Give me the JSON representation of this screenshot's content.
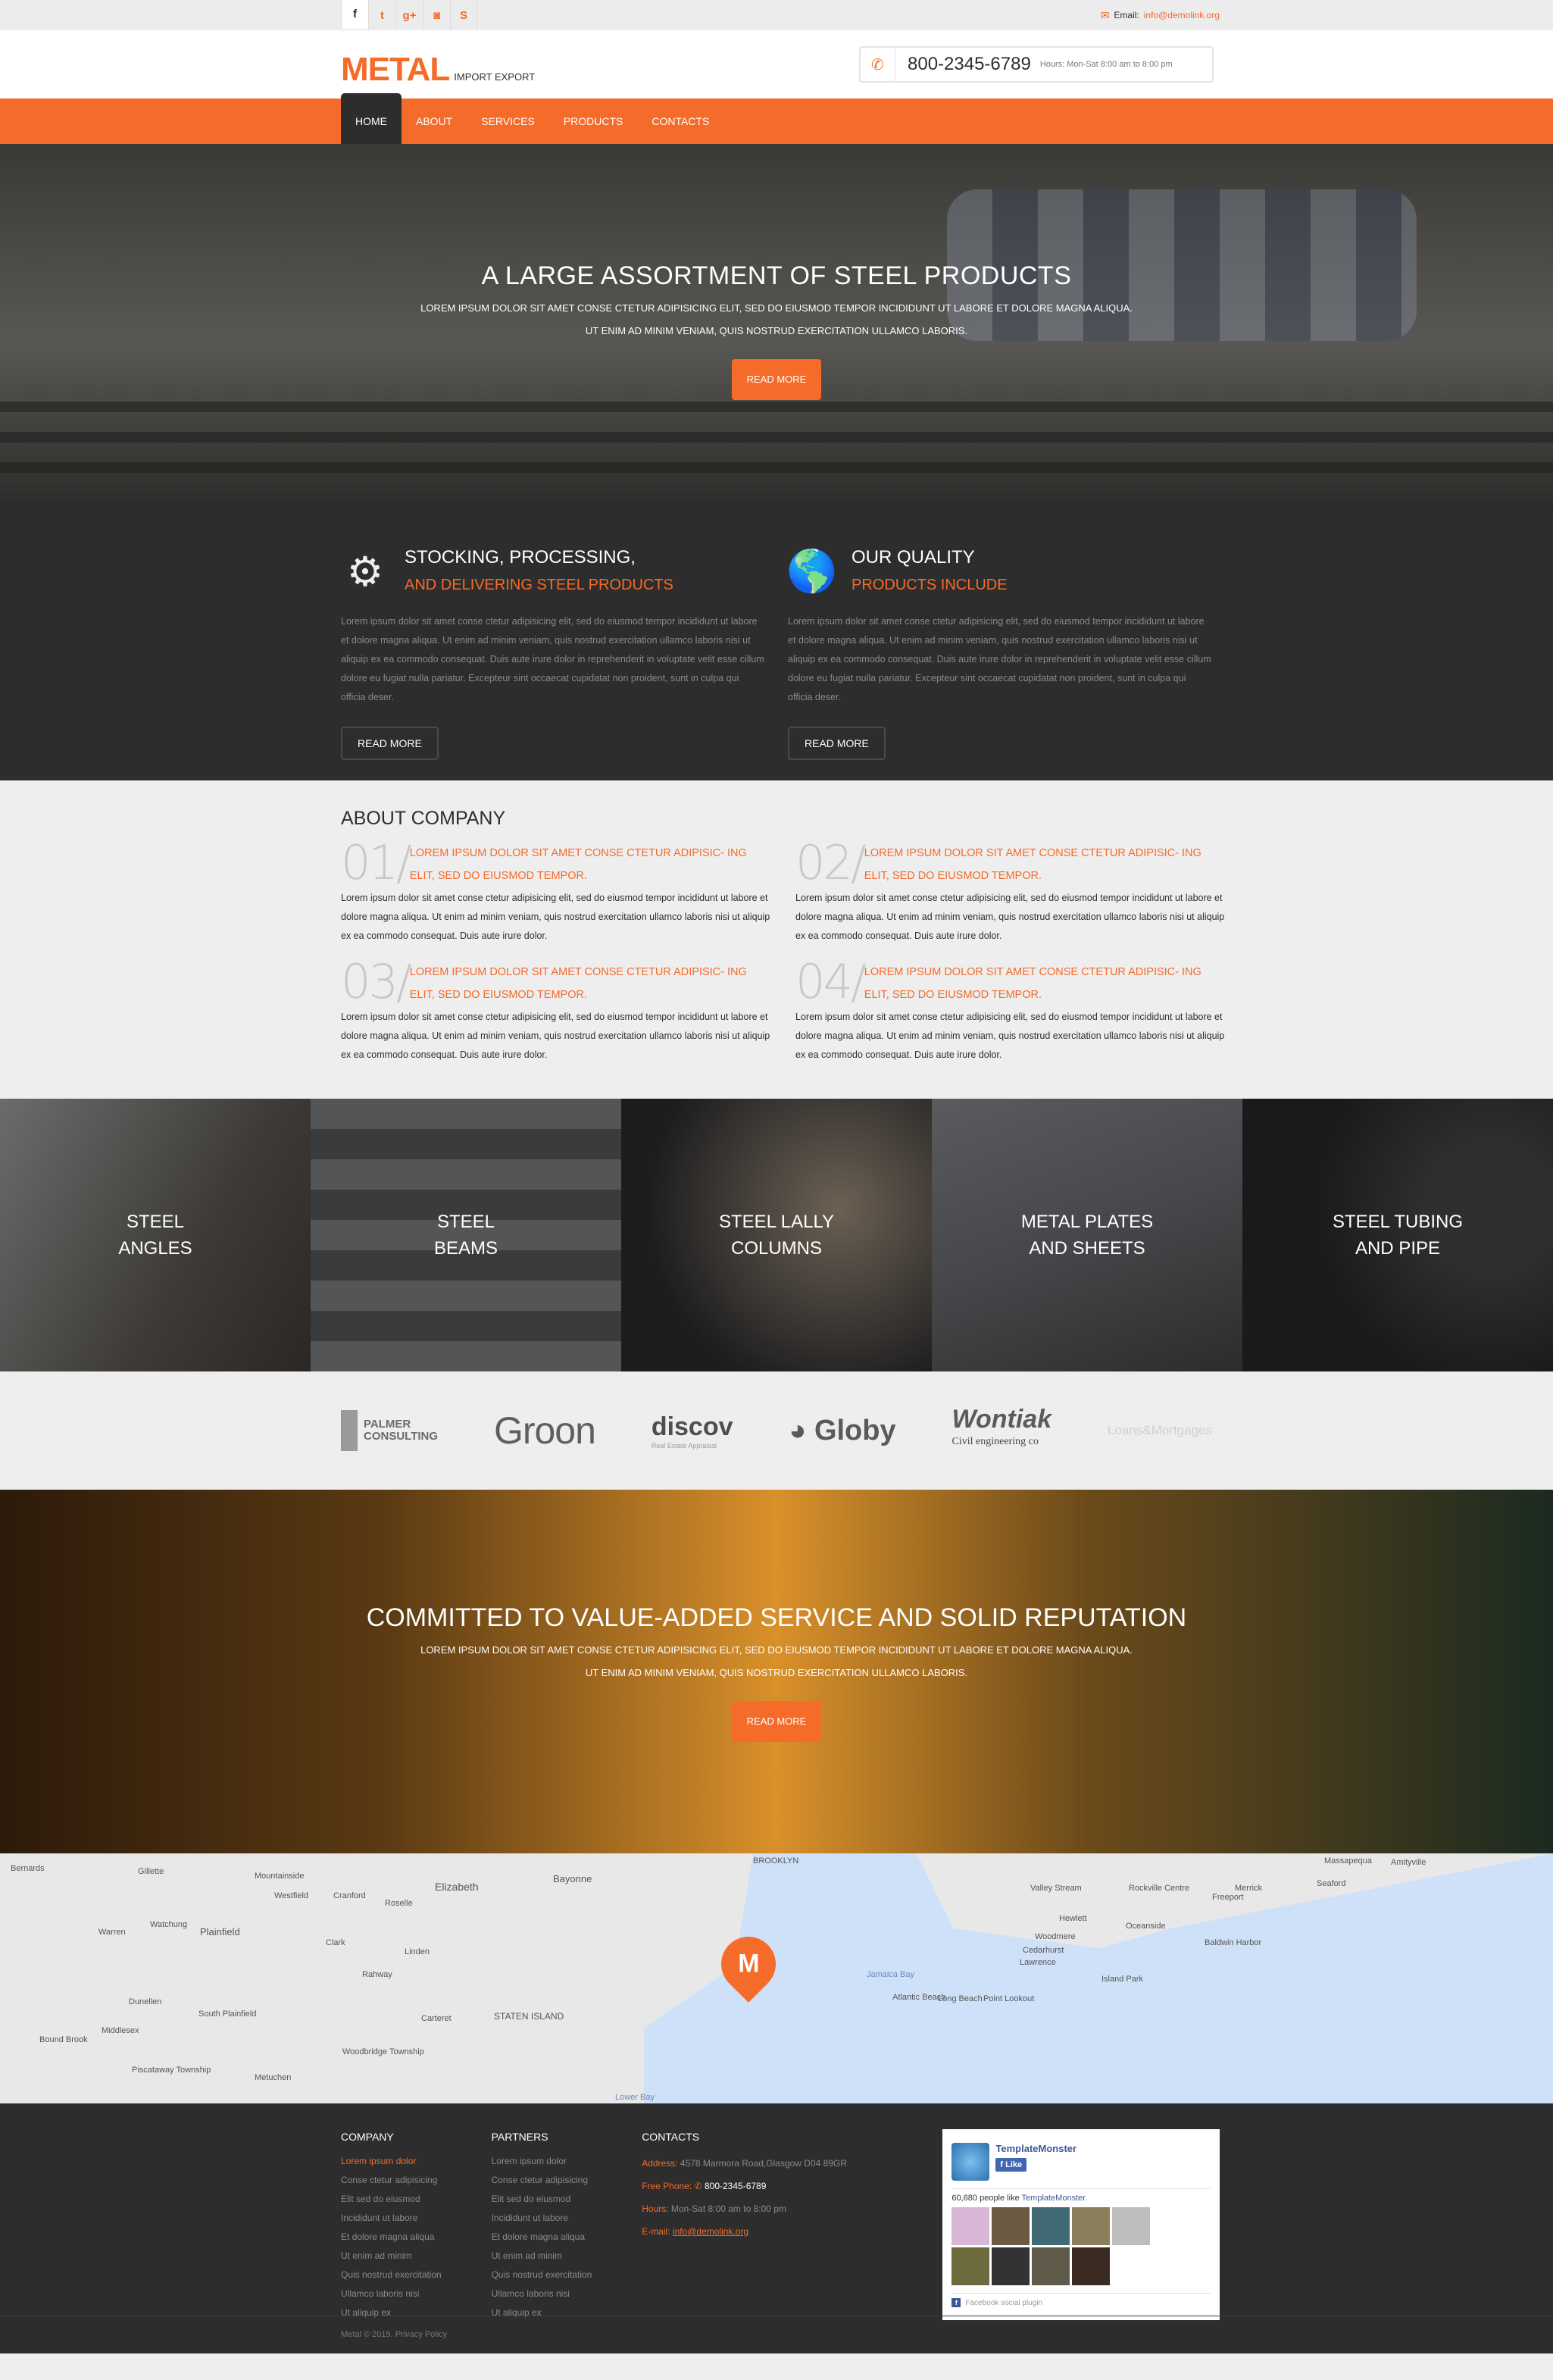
{
  "topbar": {
    "social_icons": [
      {
        "name": "facebook-icon",
        "glyph": "f"
      },
      {
        "name": "twitter-icon",
        "glyph": "t"
      },
      {
        "name": "google-plus-icon",
        "glyph": "g+"
      },
      {
        "name": "instagram-icon",
        "glyph": "◙"
      },
      {
        "name": "skype-icon",
        "glyph": "S"
      }
    ],
    "email_label": "Email:",
    "email": "info@demolink.org"
  },
  "header": {
    "logo_main": "METAL",
    "logo_sub": "IMPORT EXPORT",
    "phone": "800-2345-6789",
    "hours": "Hours: Mon-Sat 8:00 am to 8:00 pm"
  },
  "nav": [
    "HOME",
    "ABOUT",
    "SERVICES",
    "PRODUCTS",
    "CONTACTS"
  ],
  "hero": {
    "title": "A LARGE ASSORTMENT OF STEEL PRODUCTS",
    "line1": "LOREM IPSUM DOLOR SIT AMET CONSE CTETUR ADIPISICING ELIT, SED DO EIUSMOD TEMPOR INCIDIDUNT UT LABORE ET DOLORE MAGNA ALIQUA.",
    "line2": "UT ENIM AD MINIM VENIAM, QUIS NOSTRUD EXERCITATION ULLAMCO LABORIS.",
    "button": "READ MORE"
  },
  "features": [
    {
      "icon": "⚙",
      "title": "STOCKING, PROCESSING,",
      "subtitle": "AND DELIVERING STEEL PRODUCTS",
      "body": "Lorem ipsum dolor sit amet conse ctetur adipisicing elit, sed do eiusmod tempor incididunt ut labore et dolore magna aliqua. Ut enim ad minim veniam, quis nostrud exercitation ullamco laboris nisi ut aliquip ex ea commodo consequat. Duis aute irure dolor in reprehenderit in voluptate velit esse cillum dolore eu fugiat nulla pariatur. Excepteur sint occaecat cupidatat non proident, sunt in culpa qui officia deser.",
      "button": "READ MORE"
    },
    {
      "icon": "🌎",
      "title": "OUR QUALITY",
      "subtitle": "PRODUCTS INCLUDE",
      "body": "Lorem ipsum dolor sit amet conse ctetur adipisicing elit, sed do eiusmod tempor incididunt ut labore et dolore magna aliqua. Ut enim ad minim veniam, quis nostrud exercitation ullamco laboris nisi ut aliquip ex ea commodo consequat. Duis aute irure dolor in reprehenderit in voluptate velit esse cillum dolore eu fugiat nulla pariatur. Excepteur sint occaecat cupidatat non proident, sunt in culpa qui officia deser.",
      "button": "READ MORE"
    }
  ],
  "about": {
    "title": "ABOUT COMPANY",
    "items": [
      {
        "num": "01/",
        "title": "LOREM IPSUM DOLOR SIT AMET CONSE CTETUR ADIPISIC- ING ELIT, SED DO EIUSMOD TEMPOR.",
        "body": "Lorem ipsum dolor sit amet conse ctetur adipisicing elit, sed do eiusmod tempor incididunt ut labore et dolore magna aliqua. Ut enim ad minim veniam, quis nostrud exercitation ullamco laboris nisi ut aliquip ex ea commodo consequat. Duis aute irure dolor."
      },
      {
        "num": "02/",
        "title": "LOREM IPSUM DOLOR SIT AMET CONSE CTETUR ADIPISIC- ING ELIT, SED DO EIUSMOD TEMPOR.",
        "body": "Lorem ipsum dolor sit amet conse ctetur adipisicing elit, sed do eiusmod tempor incididunt ut labore et dolore magna aliqua. Ut enim ad minim veniam, quis nostrud exercitation ullamco laboris nisi ut aliquip ex ea commodo consequat. Duis aute irure dolor."
      },
      {
        "num": "03/",
        "title": "LOREM IPSUM DOLOR SIT AMET CONSE CTETUR ADIPISIC- ING ELIT, SED DO EIUSMOD TEMPOR.",
        "body": "Lorem ipsum dolor sit amet conse ctetur adipisicing elit, sed do eiusmod tempor incididunt ut labore et dolore magna aliqua. Ut enim ad minim veniam, quis nostrud exercitation ullamco laboris nisi ut aliquip ex ea commodo consequat. Duis aute irure dolor."
      },
      {
        "num": "04/",
        "title": "LOREM IPSUM DOLOR SIT AMET CONSE CTETUR ADIPISIC- ING ELIT, SED DO EIUSMOD TEMPOR.",
        "body": "Lorem ipsum dolor sit amet conse ctetur adipisicing elit, sed do eiusmod tempor incididunt ut labore et dolore magna aliqua. Ut enim ad minim veniam, quis nostrud exercitation ullamco laboris nisi ut aliquip ex ea commodo consequat. Duis aute irure dolor."
      }
    ]
  },
  "products": [
    {
      "line1": "STEEL",
      "line2": "ANGLES"
    },
    {
      "line1": "STEEL",
      "line2": "BEAMS"
    },
    {
      "line1": "STEEL LALLY",
      "line2": "COLUMNS"
    },
    {
      "line1": "METAL PLATES",
      "line2": "AND SHEETS"
    },
    {
      "line1": "STEEL TUBING",
      "line2": "AND PIPE"
    }
  ],
  "clients": {
    "palmer": {
      "line1": "PALMER",
      "line2": "CONSULTING"
    },
    "groon": "Groon",
    "discov": {
      "name": "discov",
      "tagline": "Real Estate Appraisal"
    },
    "globy": "Globy",
    "wontiak": {
      "name": "Wontiak",
      "tagline": "Civil engineering co"
    },
    "loans": "Loans&Mortgages"
  },
  "cta": {
    "title": "COMMITTED TO VALUE-ADDED SERVICE AND SOLID REPUTATION",
    "line1": "LOREM IPSUM DOLOR SIT AMET CONSE CTETUR ADIPISICING ELIT, SED DO EIUSMOD TEMPOR INCIDIDUNT UT LABORE ET DOLORE MAGNA ALIQUA.",
    "line2": "UT ENIM AD MINIM VENIAM, QUIS NOSTRUD EXERCITATION ULLAMCO LABORIS.",
    "button": "READ MORE"
  },
  "map": {
    "marker": "M",
    "labels": [
      "Bernards",
      "Gillette",
      "Mountainside",
      "Westfield",
      "Cranford",
      "Elizabeth",
      "Bayonne",
      "Warren",
      "Watchung",
      "Plainfield",
      "Roselle",
      "Clark",
      "Linden",
      "Rahway",
      "Dunellen",
      "South Plainfield",
      "Middlesex",
      "Bound Brook",
      "Carteret",
      "Woodbridge Township",
      "Piscataway Township",
      "Metuchen",
      "STATEN ISLAND",
      "BROOKLYN",
      "Jamaica Bay",
      "Valley Stream",
      "Rockville Centre",
      "Hewlett",
      "Oceanside",
      "Woodmere",
      "Cedarhurst",
      "Lawrence",
      "Freeport",
      "Merrick",
      "Baldwin Harbor",
      "Island Park",
      "Atlantic Beach",
      "Long Beach",
      "Point Lookout",
      "Seaford",
      "Massapequa",
      "Amityville",
      "Lower Bay"
    ]
  },
  "footer": {
    "company": {
      "title": "COMPANY",
      "links": [
        "Lorem ipsum dolor",
        "Conse ctetur adipisicing",
        "Elit sed do eiusmod",
        "Incididunt ut labore",
        "Et dolore magna aliqua",
        "Ut enim ad minim",
        "Quis nostrud exercitation",
        "Ullamco laboris nisi",
        "Ut aliquip ex"
      ]
    },
    "partners": {
      "title": "PARTNERS",
      "links": [
        "Lorem ipsum dolor",
        "Conse ctetur adipisicing",
        "Elit sed do eiusmod",
        "Incididunt ut labore",
        "Et dolore magna aliqua",
        "Ut enim ad minim",
        "Quis nostrud exercitation",
        "Ullamco laboris nisi",
        "Ut aliquip ex"
      ]
    },
    "contacts": {
      "title": "CONTACTS",
      "address_label": "Address:",
      "address": "4578 Marmora Road,Glasgow D04 89GR",
      "phone_label": "Free Phone:",
      "phone": "800-2345-6789",
      "hours_label": "Hours:",
      "hours": "Mon-Sat 8:00 am to 8:00 pm",
      "email_label": "E-mail:",
      "email": "info@demolink.org"
    },
    "facebook": {
      "page_name": "TemplateMonster",
      "like_label": "Like",
      "count_text": "60,680 people like",
      "count_link": "TemplateMonster.",
      "plugin_label": "Facebook social plugin"
    },
    "copyright": "Metal © 2015.",
    "privacy": "Privacy Policy"
  }
}
